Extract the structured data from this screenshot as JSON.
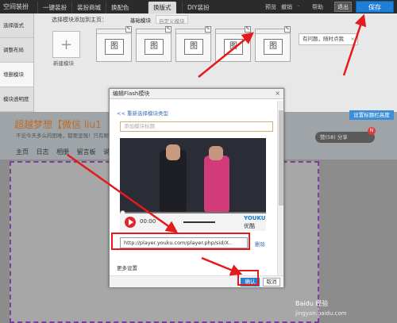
{
  "topbar": {
    "brand": "空间装扮",
    "tabs": [
      "一键装扮",
      "装扮商城",
      "换配色",
      "换版式",
      "DIY装扮"
    ],
    "active_tab": 3,
    "links": [
      "预览",
      "撤销",
      "·",
      "帮助"
    ],
    "exit_label": "退出",
    "save_label": "保存"
  },
  "sidebar": {
    "items": [
      "选择版式",
      "调整布局",
      "增删模块",
      "模块透明度"
    ],
    "active": 2
  },
  "panel": {
    "header": "选择模块添加到主页：",
    "subtab_basic": "基础模块",
    "subtab_custom": "自定义模块",
    "add_label": "新建模块",
    "thumb_glyph": "图",
    "tooltip": "有问题，随时点我",
    "tooltip_close": "×"
  },
  "preview": {
    "blog_title": "超越梦想【微信 liu1",
    "slogan": "不论今天多么的困难，都要坚强！只有眼",
    "nav": [
      "主页",
      "日志",
      "相册",
      "留言板",
      "说说"
    ],
    "set_header": "设置标题栏高度",
    "like_text": "赞(58)    分享",
    "badge": "N"
  },
  "dialog": {
    "title": "编辑Flash模块",
    "close": "×",
    "back_link": "<< 重新选择模块类型",
    "title_placeholder": "添加模块标题",
    "time": "00:00",
    "brand": "YOUKU",
    "brand_sub": "优酷",
    "url": "http://player.youku.com/player.php/sid/X..",
    "delete": "删除",
    "more": "更多设置",
    "ok": "确认",
    "cancel": "取消"
  },
  "watermark": {
    "line1": "Baidu 经验",
    "line2": "jingyan.baidu.com"
  },
  "colors": {
    "accent": "#1f7fd8",
    "annotation": "#e51a1a"
  }
}
